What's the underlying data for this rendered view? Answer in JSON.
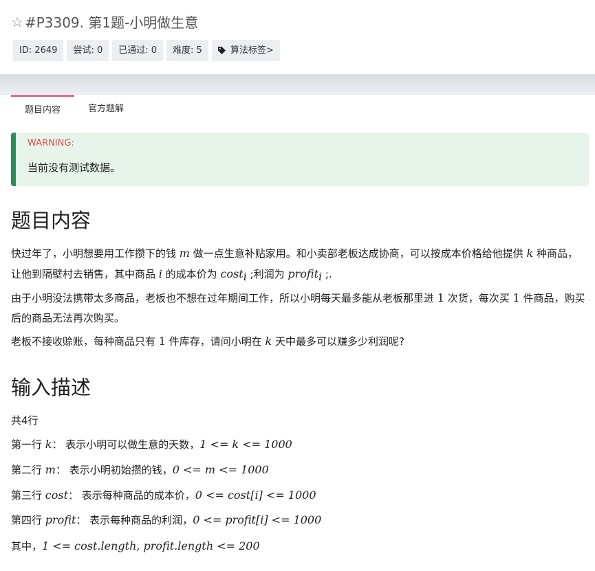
{
  "header": {
    "title": "#P3309. 第1题-小明做生意",
    "badges": {
      "id": "ID: 2649",
      "tried": "尝试: 0",
      "passed": "已通过: 0",
      "difficulty": "难度: 5",
      "tags": "算法标签>"
    }
  },
  "tabs": [
    "题目内容",
    "官方题解"
  ],
  "warning": {
    "title": "WARNING:",
    "message": "当前没有测试数据。"
  },
  "sections": {
    "content_heading": "题目内容",
    "input_heading": "输入描述"
  },
  "problem": {
    "p1_a": "快过年了，小明想要用工作攒下的钱 ",
    "m_var": "m",
    "p1_b": " 做一点生意补贴家用。和小卖部老板达成协商，可以按成本价格给他提供 ",
    "k_var": "k",
    "p1_c": " 种商品，让他到隔壁村去销售，其中商品 ",
    "i_var": "i",
    "p1_d": " 的成本价为 ",
    "cost_var": "cost",
    "p1_e": " ;利润为 ",
    "profit_var": "profit",
    "p1_f": " ;.",
    "p2_a": "由于小明没法携带太多商品，老板也不想在过年期间工作，所以小明每天最多能从老板那里进 ",
    "p2_one": "1",
    "p2_b": " 次货，每次买 ",
    "p2_c": " 件商品，购买后的商品无法再次购买。",
    "p3_a": "老板不接收赊账，每种商品只有 ",
    "p3_b": " 件库存，请问小明在 ",
    "p3_c": " 天中最多可以赚多少利润呢?"
  },
  "input": {
    "total": "共4行",
    "l1_a": "第一行 ",
    "l1_b": "： 表示小明可以做生意的天数，",
    "l1_expr": "1 <= k <= 1000",
    "l2_a": "第二行 ",
    "l2_b": "： 表示小明初始攒的钱，",
    "l2_expr": "0 <= m <= 1000",
    "l3_a": "第三行 ",
    "l3_b": "： 表示每种商品的成本价，",
    "l3_expr": "0 <= cost[i] <= 1000",
    "l4_a": "第四行 ",
    "l4_b": "： 表示每种商品的利润，",
    "l4_expr": "0 <= profit[i] <= 1000",
    "l5_a": "其中，",
    "l5_expr": "1 <= cost.length, profit.length <= 200"
  }
}
